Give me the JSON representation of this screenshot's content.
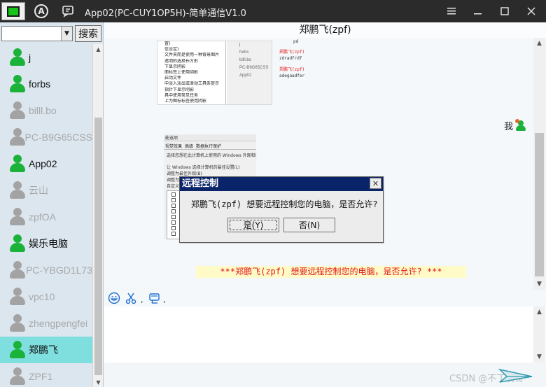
{
  "window": {
    "title": "App02(PC-CUY1OP5H)-简单通信V1.0"
  },
  "toolbar_icons": [
    "monitor-icon",
    "a-circle-icon",
    "chat-icon"
  ],
  "search": {
    "value": "",
    "button_label": "搜索"
  },
  "contacts": [
    {
      "name": "j",
      "status": "online"
    },
    {
      "name": "forbs",
      "status": "online"
    },
    {
      "name": "billl.bo",
      "status": "offline"
    },
    {
      "name": "PC-B9G65CSS",
      "status": "offline"
    },
    {
      "name": "App02",
      "status": "online"
    },
    {
      "name": "云山",
      "status": "offline"
    },
    {
      "name": "zpfOA",
      "status": "offline"
    },
    {
      "name": "娱乐电脑",
      "status": "online"
    },
    {
      "name": "PC-YBGD1L73",
      "status": "offline"
    },
    {
      "name": "vpc10",
      "status": "offline"
    },
    {
      "name": "zhengpengfei",
      "status": "offline"
    },
    {
      "name": "郑鹏飞",
      "status": "online",
      "selected": true
    },
    {
      "name": "ZPF1",
      "status": "offline"
    }
  ],
  "chat": {
    "header": "郑鹏飞(zpf)",
    "me_label": "我",
    "shot1_menu": [
      "置)",
      "信设定)",
      "文件夹而是使用一种背景图片",
      "透明的选择长方形",
      "下显示阴影",
      "面标签上使用阴影",
      "启动文件",
      "中淡入淡出或滑动工具条提示",
      "指针下显示阴影",
      "具中使用常见任务",
      "上为图标标签使用阴影"
    ],
    "shot1_list": [
      "j",
      "forbs",
      "billl.bo",
      "PC-B9G65CSS",
      "App02"
    ],
    "shot1_side": [
      "pd",
      "郑鹏飞(zpf)",
      "zdradfrdf",
      "郑鹏飞(zpf)",
      "adegaadfer"
    ],
    "shot2_caption": "能选项",
    "shot2_tabs": [
      "视觉效果",
      "高级",
      "数据执行保护"
    ],
    "shot2_lines": [
      "选择您想在此计算机上使用的 Windows 外观和性能设",
      "让 Windows 选择计算机的最佳设置(L)",
      "调整为最佳外观(B)",
      "调整为最佳性能",
      "自定义"
    ],
    "notice": "***郑鹏飞(zpf) 想要远程控制您的电脑，是否允许? ***"
  },
  "dialog": {
    "title": "远程控制",
    "message": "郑鹏飞(zpf) 想要远程控制您的电脑，是否允许?",
    "yes_label": "是(Y)",
    "no_label": "否(N)"
  },
  "input_toolbar": {
    "separator": ","
  },
  "watermark": "CSDN @不丁前哥",
  "colors": {
    "titlebar": "#2b2b2b",
    "selected_contact": "#7fdede",
    "online": "#1bb23a",
    "offline": "#a3a3a3",
    "dialog_title": "#0a2469",
    "notice_text": "#e31616",
    "notice_bg": "#fffbc8"
  }
}
